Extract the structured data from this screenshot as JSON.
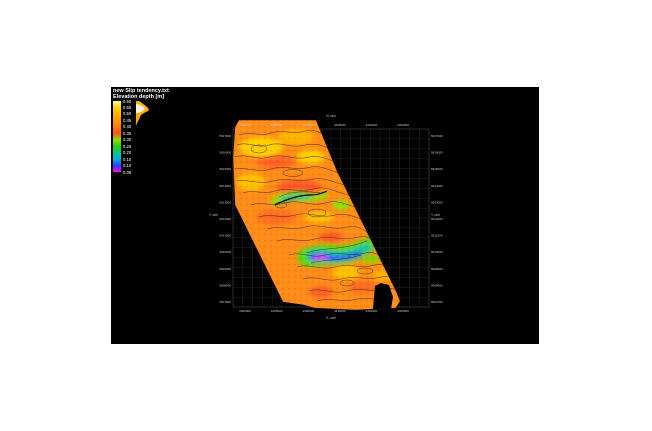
{
  "window": {
    "background_color": "#000000",
    "page_background": "#ffffff"
  },
  "legend": {
    "title_line1": "new Slip tendency.txt",
    "title_line2": "Elevation depth [m]",
    "ticks": [
      "0.60",
      "0.55",
      "0.50",
      "0.45",
      "0.40",
      "0.35",
      "0.30",
      "0.25",
      "0.20",
      "0.15",
      "0.10",
      "0.05"
    ],
    "colors": [
      "#fffc9a",
      "#ffd400",
      "#ffb000",
      "#ff9a00",
      "#ff7a10",
      "#ff5020",
      "#8ee000",
      "#29d000",
      "#00c890",
      "#00b0e0",
      "#2040ff",
      "#ff00ff"
    ]
  },
  "map": {
    "axis_top_title": "N, utm",
    "axis_bottom_title": "E, utm",
    "axis_left_title": "Y, utm",
    "axis_right_title": "Y, utm",
    "x_ticks": [
      "4420000",
      "4425000",
      "4430000",
      "4435000",
      "4440000",
      "4445000"
    ],
    "y_ticks": [
      "5617000",
      "5616000",
      "5615000",
      "5614000",
      "5613000",
      "5612000",
      "5611000",
      "5610000",
      "5609000",
      "5608000",
      "5607000"
    ],
    "grid": true
  }
}
